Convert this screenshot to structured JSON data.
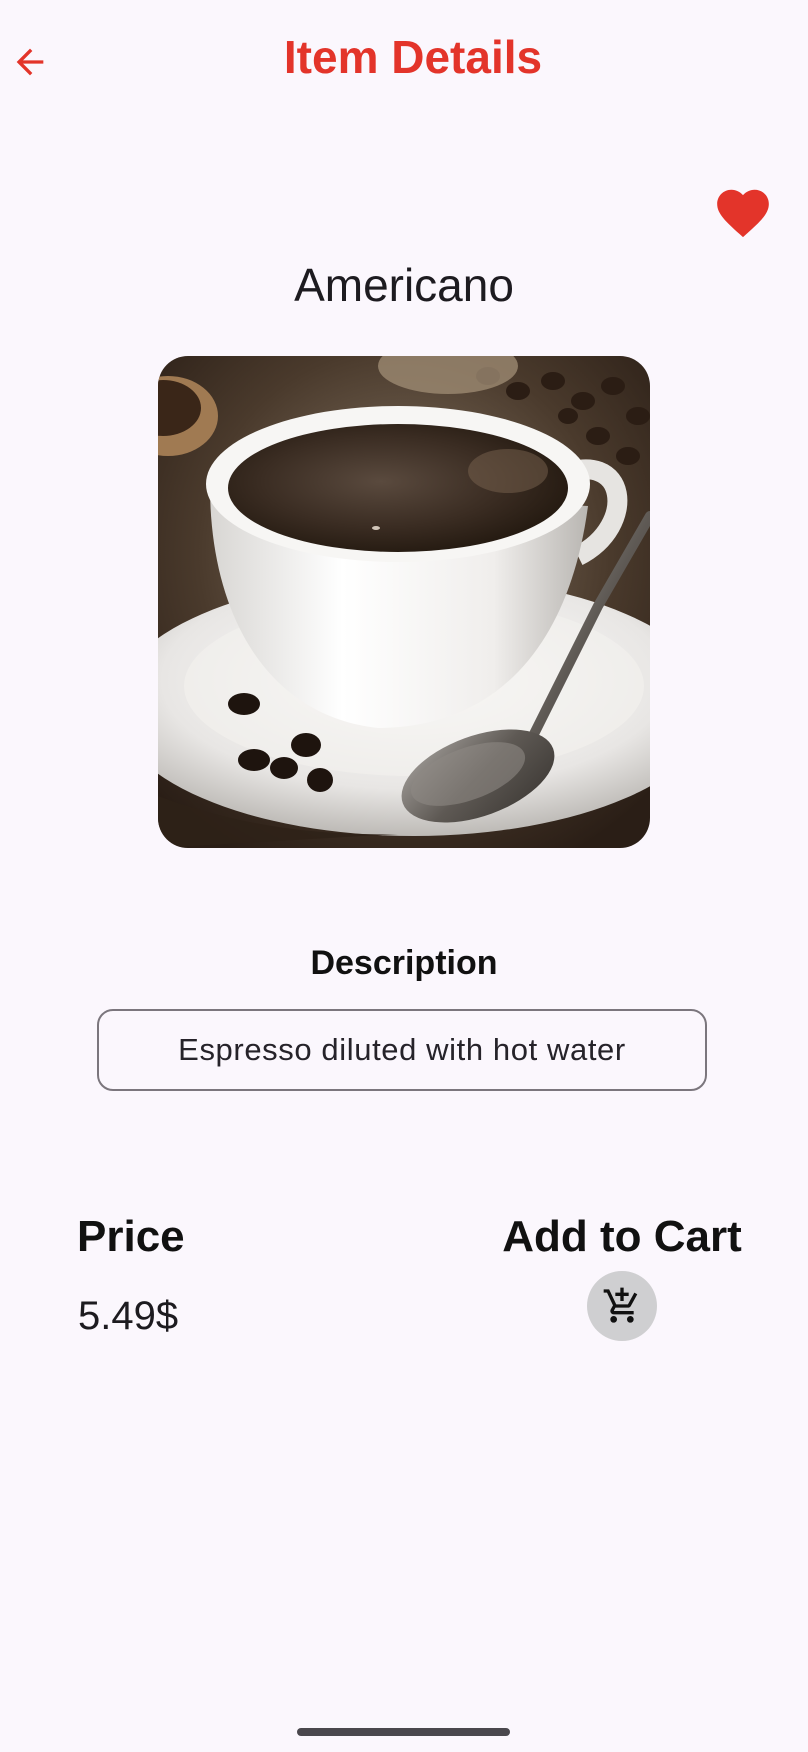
{
  "header": {
    "title": "Item Details",
    "back_icon": "arrow-back-icon"
  },
  "favorite": {
    "icon": "heart-filled-icon",
    "state": "favorited",
    "color": "#e3342a"
  },
  "item": {
    "name": "Americano",
    "image_subject": "coffee-cup-photo"
  },
  "description": {
    "heading": "Description",
    "text": "Espresso diluted with hot water"
  },
  "price": {
    "label": "Price",
    "value": "5.49$"
  },
  "cart": {
    "label": "Add to Cart",
    "icon": "add-shopping-cart-icon"
  },
  "colors": {
    "accent": "#e3342a",
    "background": "#fbf7fd",
    "cart_button_bg": "#cfcfd1"
  }
}
